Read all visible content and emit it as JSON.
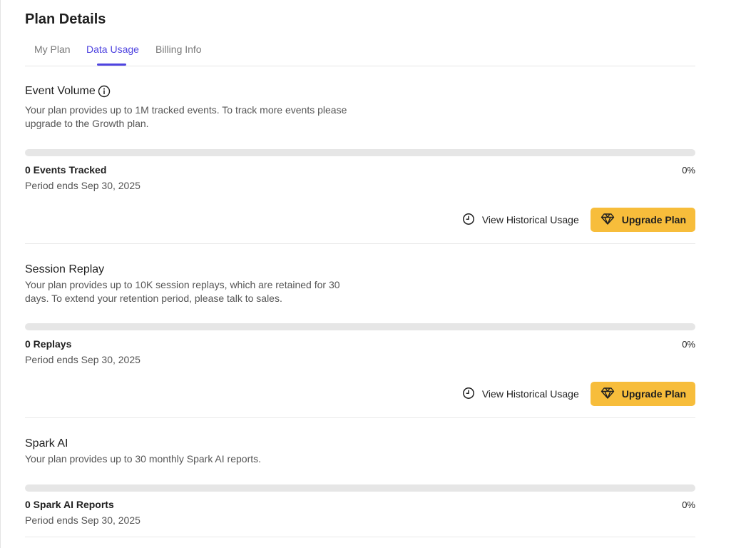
{
  "page": {
    "title": "Plan Details"
  },
  "tabs": [
    {
      "label": "My Plan",
      "active": false
    },
    {
      "label": "Data Usage",
      "active": true
    },
    {
      "label": "Billing Info",
      "active": false
    }
  ],
  "sections": [
    {
      "title": "Event Volume",
      "has_info_icon": true,
      "description": "Your plan provides up to 1M tracked events. To track more events please upgrade to the Growth plan.",
      "usage_label": "0 Events Tracked",
      "usage_percent_text": "0%",
      "usage_fraction": 0,
      "period": "Period ends Sep 30, 2025",
      "history_label": "View Historical Usage",
      "upgrade_label": "Upgrade Plan"
    },
    {
      "title": "Session Replay",
      "description": "Your plan provides up to 10K session replays, which are retained for 30 days. To extend your retention period, please talk to sales.",
      "usage_label": "0 Replays",
      "usage_percent_text": "0%",
      "usage_fraction": 0,
      "period": "Period ends Sep 30, 2025",
      "history_label": "View Historical Usage",
      "upgrade_label": "Upgrade Plan"
    },
    {
      "title": "Spark AI",
      "description": "Your plan provides up to 30 monthly Spark AI reports.",
      "usage_label": "0 Spark AI Reports",
      "usage_percent_text": "0%",
      "usage_fraction": 0,
      "period": "Period ends Sep 30, 2025"
    }
  ],
  "colors": {
    "accent": "#4f44e0",
    "upgrade_button": "#f7bd3b",
    "progress_track": "#e6e6e6"
  },
  "icons": {
    "info": "info-icon",
    "history": "clock-icon",
    "upgrade": "diamond-icon"
  }
}
